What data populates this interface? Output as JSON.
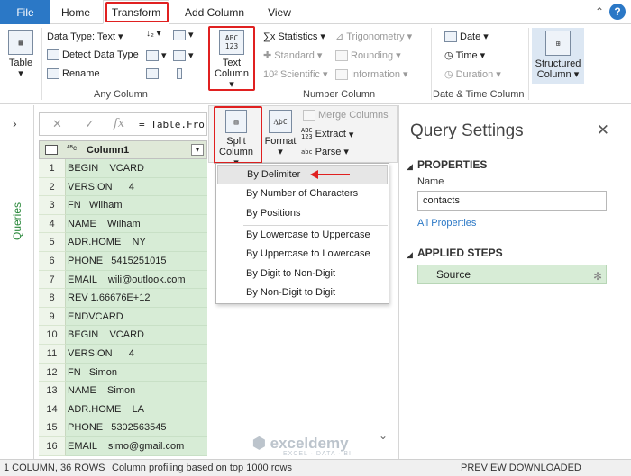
{
  "tabs": {
    "file": "File",
    "home": "Home",
    "transform": "Transform",
    "add_column": "Add Column",
    "view": "View"
  },
  "help": "?",
  "ribbon": {
    "table_btn": "Table",
    "data_type": "Data Type: Text",
    "detect_data_type": "Detect Data Type",
    "rename": "Rename",
    "any_column_label": "Any Column",
    "text_column": "Text\nColumn",
    "text_column_line1": "Text",
    "text_column_line2": "Column",
    "statistics": "Statistics",
    "standard": "Standard",
    "scientific": "Scientific",
    "trigonometry": "Trigonometry",
    "rounding": "Rounding",
    "information": "Information",
    "number_column_label": "Number Column",
    "date": "Date",
    "time": "Time",
    "duration": "Duration",
    "date_time_label": "Date & Time Column",
    "structured_line1": "Structured",
    "structured_line2": "Column"
  },
  "text_column_panel": {
    "split_line1": "Split",
    "split_line2": "Column",
    "format": "Format",
    "merge_columns": "Merge Columns",
    "extract": "Extract",
    "parse": "Parse"
  },
  "split_menu": [
    "By Delimiter",
    "By Number of Characters",
    "By Positions",
    "By Lowercase to Uppercase",
    "By Uppercase to Lowercase",
    "By Digit to Non-Digit",
    "By Non-Digit to Digit"
  ],
  "queries_label": "Queries",
  "formula": "= Table.Fro",
  "grid": {
    "column_name": "Column1",
    "rows": [
      {
        "n": "1",
        "v": "BEGIN    VCARD"
      },
      {
        "n": "2",
        "v": "VERSION      4"
      },
      {
        "n": "3",
        "v": "FN   Wilham"
      },
      {
        "n": "4",
        "v": "NAME    Wilham"
      },
      {
        "n": "5",
        "v": "ADR.HOME    NY"
      },
      {
        "n": "6",
        "v": "PHONE   5415251015"
      },
      {
        "n": "7",
        "v": "EMAIL    wili@outlook.com"
      },
      {
        "n": "8",
        "v": "REV 1.66676E+12"
      },
      {
        "n": "9",
        "v": "ENDVCARD"
      },
      {
        "n": "10",
        "v": "BEGIN    VCARD"
      },
      {
        "n": "11",
        "v": "VERSION      4"
      },
      {
        "n": "12",
        "v": "FN   Simon"
      },
      {
        "n": "13",
        "v": "NAME    Simon"
      },
      {
        "n": "14",
        "v": "ADR.HOME    LA"
      },
      {
        "n": "15",
        "v": "PHONE   5302563545"
      },
      {
        "n": "16",
        "v": "EMAIL    simo@gmail.com"
      }
    ]
  },
  "query_settings": {
    "title": "Query Settings",
    "properties": "PROPERTIES",
    "name_label": "Name",
    "name_value": "contacts",
    "all_properties": "All Properties",
    "applied_steps": "APPLIED STEPS",
    "step_source": "Source"
  },
  "status": {
    "left": "1 COLUMN, 36 ROWS",
    "profiling": "Column profiling based on top 1000 rows",
    "right": "PREVIEW DOWNLOADED"
  },
  "watermark": {
    "brand": "exceldemy",
    "sub": "EXCEL · DATA · BI"
  },
  "accent": "#2b78c6",
  "highlight_red": "#e02020",
  "row_green": "#d7ecd6"
}
